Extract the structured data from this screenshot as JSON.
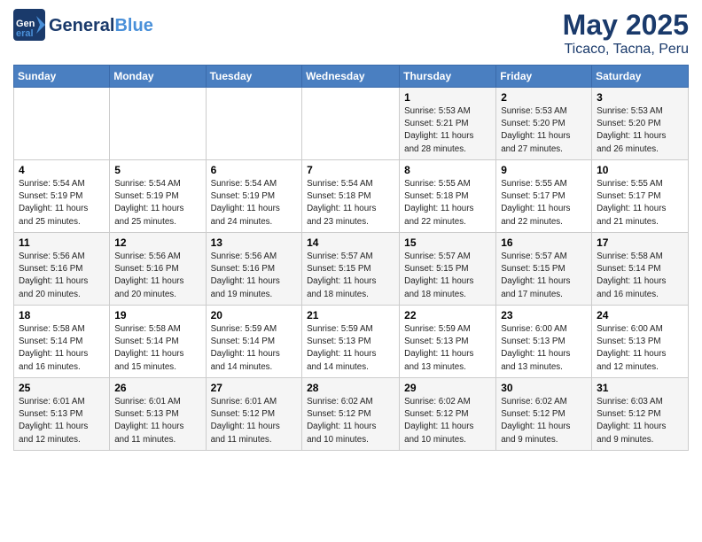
{
  "header": {
    "logo_line1": "General",
    "logo_line2": "Blue",
    "title": "May 2025",
    "subtitle": "Ticaco, Tacna, Peru"
  },
  "days_of_week": [
    "Sunday",
    "Monday",
    "Tuesday",
    "Wednesday",
    "Thursday",
    "Friday",
    "Saturday"
  ],
  "weeks": [
    [
      {
        "day": "",
        "info": ""
      },
      {
        "day": "",
        "info": ""
      },
      {
        "day": "",
        "info": ""
      },
      {
        "day": "",
        "info": ""
      },
      {
        "day": "1",
        "info": "Sunrise: 5:53 AM\nSunset: 5:21 PM\nDaylight: 11 hours\nand 28 minutes."
      },
      {
        "day": "2",
        "info": "Sunrise: 5:53 AM\nSunset: 5:20 PM\nDaylight: 11 hours\nand 27 minutes."
      },
      {
        "day": "3",
        "info": "Sunrise: 5:53 AM\nSunset: 5:20 PM\nDaylight: 11 hours\nand 26 minutes."
      }
    ],
    [
      {
        "day": "4",
        "info": "Sunrise: 5:54 AM\nSunset: 5:19 PM\nDaylight: 11 hours\nand 25 minutes."
      },
      {
        "day": "5",
        "info": "Sunrise: 5:54 AM\nSunset: 5:19 PM\nDaylight: 11 hours\nand 25 minutes."
      },
      {
        "day": "6",
        "info": "Sunrise: 5:54 AM\nSunset: 5:19 PM\nDaylight: 11 hours\nand 24 minutes."
      },
      {
        "day": "7",
        "info": "Sunrise: 5:54 AM\nSunset: 5:18 PM\nDaylight: 11 hours\nand 23 minutes."
      },
      {
        "day": "8",
        "info": "Sunrise: 5:55 AM\nSunset: 5:18 PM\nDaylight: 11 hours\nand 22 minutes."
      },
      {
        "day": "9",
        "info": "Sunrise: 5:55 AM\nSunset: 5:17 PM\nDaylight: 11 hours\nand 22 minutes."
      },
      {
        "day": "10",
        "info": "Sunrise: 5:55 AM\nSunset: 5:17 PM\nDaylight: 11 hours\nand 21 minutes."
      }
    ],
    [
      {
        "day": "11",
        "info": "Sunrise: 5:56 AM\nSunset: 5:16 PM\nDaylight: 11 hours\nand 20 minutes."
      },
      {
        "day": "12",
        "info": "Sunrise: 5:56 AM\nSunset: 5:16 PM\nDaylight: 11 hours\nand 20 minutes."
      },
      {
        "day": "13",
        "info": "Sunrise: 5:56 AM\nSunset: 5:16 PM\nDaylight: 11 hours\nand 19 minutes."
      },
      {
        "day": "14",
        "info": "Sunrise: 5:57 AM\nSunset: 5:15 PM\nDaylight: 11 hours\nand 18 minutes."
      },
      {
        "day": "15",
        "info": "Sunrise: 5:57 AM\nSunset: 5:15 PM\nDaylight: 11 hours\nand 18 minutes."
      },
      {
        "day": "16",
        "info": "Sunrise: 5:57 AM\nSunset: 5:15 PM\nDaylight: 11 hours\nand 17 minutes."
      },
      {
        "day": "17",
        "info": "Sunrise: 5:58 AM\nSunset: 5:14 PM\nDaylight: 11 hours\nand 16 minutes."
      }
    ],
    [
      {
        "day": "18",
        "info": "Sunrise: 5:58 AM\nSunset: 5:14 PM\nDaylight: 11 hours\nand 16 minutes."
      },
      {
        "day": "19",
        "info": "Sunrise: 5:58 AM\nSunset: 5:14 PM\nDaylight: 11 hours\nand 15 minutes."
      },
      {
        "day": "20",
        "info": "Sunrise: 5:59 AM\nSunset: 5:14 PM\nDaylight: 11 hours\nand 14 minutes."
      },
      {
        "day": "21",
        "info": "Sunrise: 5:59 AM\nSunset: 5:13 PM\nDaylight: 11 hours\nand 14 minutes."
      },
      {
        "day": "22",
        "info": "Sunrise: 5:59 AM\nSunset: 5:13 PM\nDaylight: 11 hours\nand 13 minutes."
      },
      {
        "day": "23",
        "info": "Sunrise: 6:00 AM\nSunset: 5:13 PM\nDaylight: 11 hours\nand 13 minutes."
      },
      {
        "day": "24",
        "info": "Sunrise: 6:00 AM\nSunset: 5:13 PM\nDaylight: 11 hours\nand 12 minutes."
      }
    ],
    [
      {
        "day": "25",
        "info": "Sunrise: 6:01 AM\nSunset: 5:13 PM\nDaylight: 11 hours\nand 12 minutes."
      },
      {
        "day": "26",
        "info": "Sunrise: 6:01 AM\nSunset: 5:13 PM\nDaylight: 11 hours\nand 11 minutes."
      },
      {
        "day": "27",
        "info": "Sunrise: 6:01 AM\nSunset: 5:12 PM\nDaylight: 11 hours\nand 11 minutes."
      },
      {
        "day": "28",
        "info": "Sunrise: 6:02 AM\nSunset: 5:12 PM\nDaylight: 11 hours\nand 10 minutes."
      },
      {
        "day": "29",
        "info": "Sunrise: 6:02 AM\nSunset: 5:12 PM\nDaylight: 11 hours\nand 10 minutes."
      },
      {
        "day": "30",
        "info": "Sunrise: 6:02 AM\nSunset: 5:12 PM\nDaylight: 11 hours\nand 9 minutes."
      },
      {
        "day": "31",
        "info": "Sunrise: 6:03 AM\nSunset: 5:12 PM\nDaylight: 11 hours\nand 9 minutes."
      }
    ]
  ]
}
